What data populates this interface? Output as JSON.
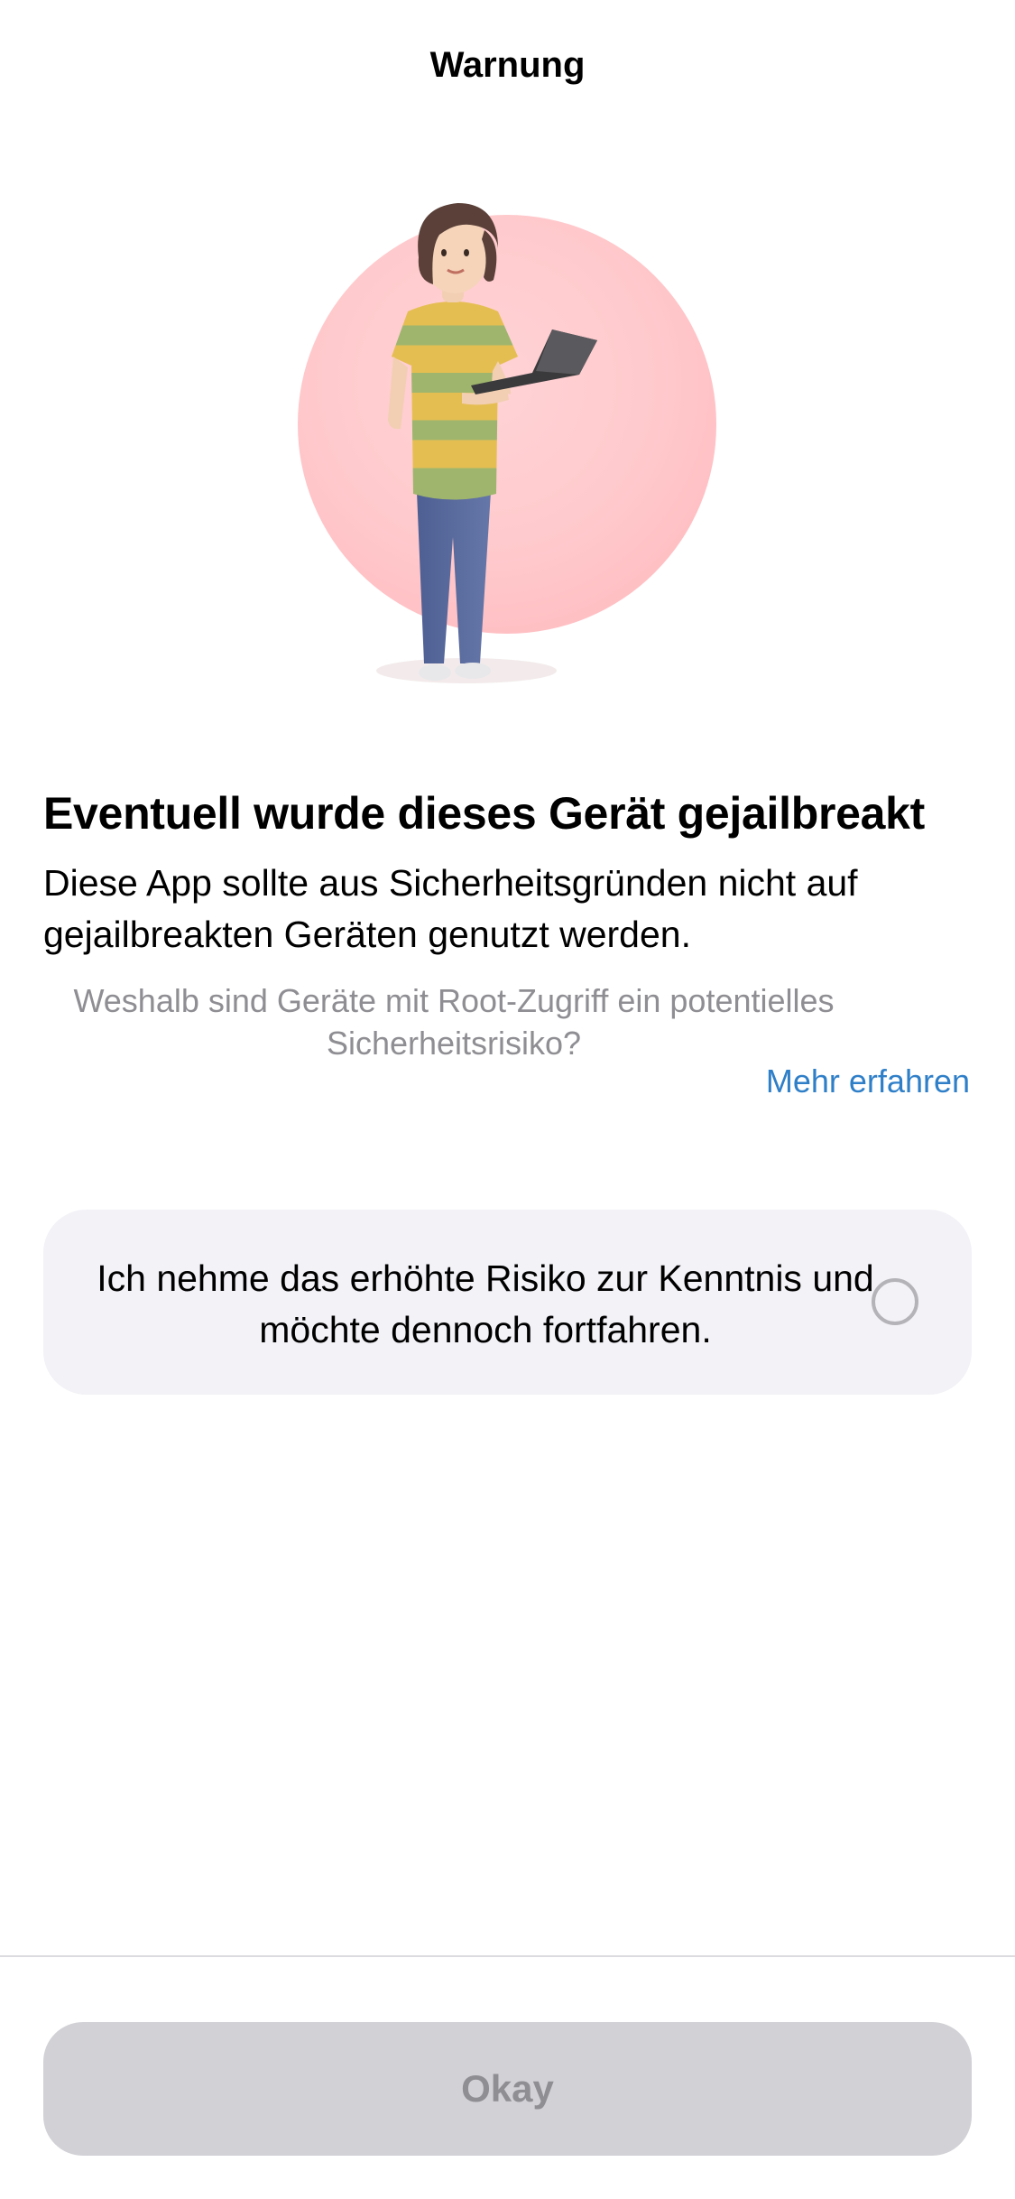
{
  "nav": {
    "title": "Warnung"
  },
  "illustration": {
    "icon": "person-with-laptop-illustration",
    "circle_color": "#ffc9cc"
  },
  "main": {
    "headline": "Eventuell wurde dieses Gerät gejailbreakt",
    "body": "Diese App sollte aus Sicherheitsgründen nicht auf gejailbreakten Geräten genutzt werden.",
    "question": "Weshalb sind Geräte mit Root-Zugriff ein potentielles Sicherheitsrisiko?",
    "learn_more": "Mehr erfahren"
  },
  "consent": {
    "text": "Ich nehme das erhöhte Risiko zur Kenntnis und möchte dennoch fortfahren.",
    "checked": false
  },
  "footer": {
    "button_label": "Okay",
    "button_enabled": false
  },
  "colors": {
    "link": "#2f7fc8",
    "card_background": "#f2f2f7",
    "button_disabled_background": "#d1d1d6",
    "button_disabled_text": "#8e8e93",
    "secondary_text": "#8e8e93"
  }
}
